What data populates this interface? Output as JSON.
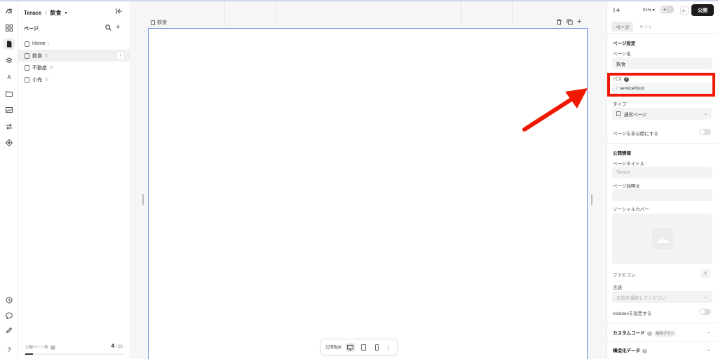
{
  "app": {
    "logo": "/S",
    "project": "Terace",
    "current_page": "飲食"
  },
  "rail_icons": [
    "grid-icon",
    "page-icon",
    "layers-icon",
    "text-icon",
    "folder-icon",
    "image-icon",
    "swap-icon",
    "component-icon",
    "history-icon",
    "comment-icon",
    "pen-icon",
    "help-icon"
  ],
  "pages_panel": {
    "heading": "ページ",
    "items": [
      {
        "name": "Home",
        "path": "/"
      },
      {
        "name": "飲食",
        "path": "/1"
      },
      {
        "name": "不動産",
        "path": "/2"
      },
      {
        "name": "小売",
        "path": "/3"
      }
    ],
    "footer_label": "公開ページ数",
    "count": "4",
    "limit": "/ 50",
    "usage_fraction": 0.08
  },
  "canvas": {
    "frame_label": "飲食",
    "width_label": "1280px"
  },
  "settings": {
    "zoom": "91%",
    "publish_label": "公開",
    "tabs": [
      "ページ",
      "サイト"
    ],
    "page_settings_title": "ページ設定",
    "page_name_label": "ページ名",
    "page_name_value": "飲食",
    "path_label": "パス",
    "path_prefix": "/",
    "path_value": "service/food",
    "type_label": "タイプ",
    "type_value": "通常ページ",
    "hide_label": "ページを非公開にする",
    "public_title": "公開情報",
    "page_title_label": "ページタイトル",
    "page_title_placeholder": "Terace",
    "description_label": "ページ説明文",
    "social_cover_label": "ソーシャルカバー",
    "favicon_label": "ファビコン",
    "language_label": "言語",
    "language_placeholder": "言語を選択してください",
    "noindex_label": "noindexを設定する",
    "custom_code_label": "カスタムコード",
    "paid_badge": "有料プラン",
    "structured_data_label": "構造化データ"
  },
  "colors": {
    "accent": "#1c1c1c",
    "frame_border": "#6c8fe6",
    "annotation": "#f01800"
  }
}
